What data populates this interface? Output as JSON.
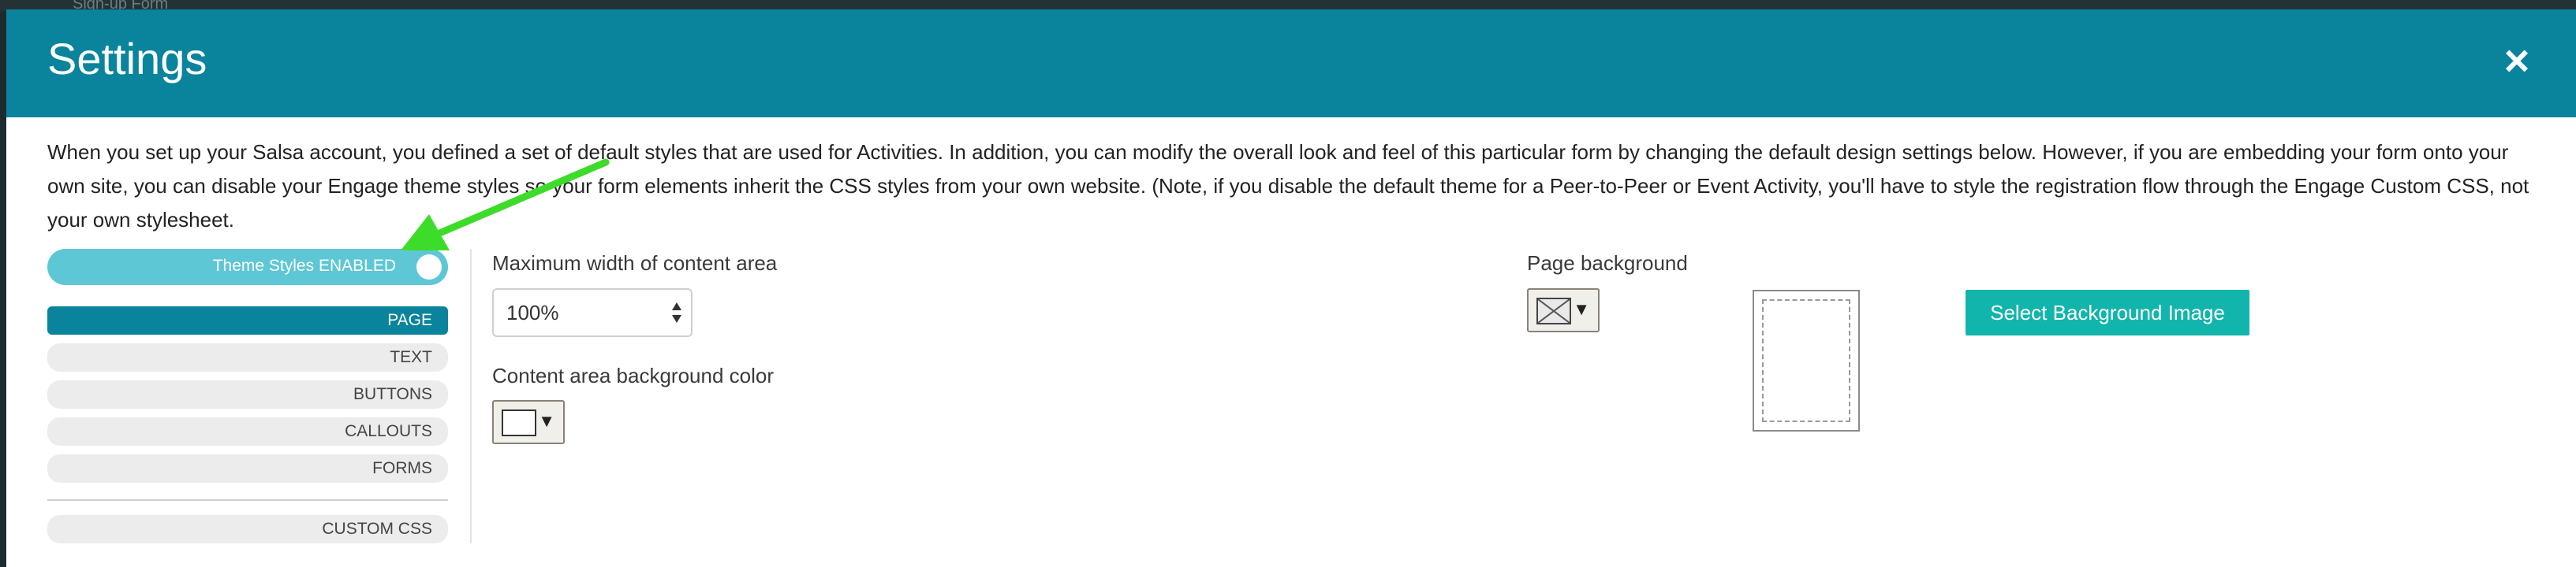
{
  "backdrop": {
    "partial_title": "Sign-up Form"
  },
  "dialog": {
    "title": "Settings",
    "close_glyph": "×",
    "intro": "When you set up your Salsa account, you defined a set of default styles that are used for Activities. In addition, you can modify the overall look and feel of this particular form by changing the default design settings below. However, if you are embedding your form onto your own site, you can disable your Engage theme styles so your form elements inherit the CSS styles from your own website. (Note, if you disable the default theme for a Peer-to-Peer or Event Activity, you'll have to style the registration flow through the Engage Custom CSS, not your own stylesheet."
  },
  "sidebar": {
    "theme_toggle": {
      "label": "Theme Styles ENABLED",
      "enabled": true
    },
    "items": [
      {
        "label": "PAGE",
        "active": true
      },
      {
        "label": "TEXT",
        "active": false
      },
      {
        "label": "BUTTONS",
        "active": false
      },
      {
        "label": "CALLOUTS",
        "active": false
      },
      {
        "label": "FORMS",
        "active": false
      }
    ],
    "custom_css": {
      "label": "CUSTOM CSS"
    }
  },
  "page_settings": {
    "max_width": {
      "label": "Maximum width of content area",
      "value": "100%"
    },
    "content_bg": {
      "label": "Content area background color",
      "color": "#ffffff"
    },
    "page_bg": {
      "label": "Page background",
      "color": null
    },
    "select_bg_image": {
      "label": "Select Background Image"
    }
  },
  "colors": {
    "header": "#0a849c",
    "toggle": "#5ec7d6",
    "button": "#12b5ab",
    "annotation_arrow": "#3ddc2a"
  },
  "icons": {
    "close": "close-icon",
    "spinner": "spinner-arrows-icon",
    "caret": "caret-down-icon",
    "empty_swatch": "empty-swatch-icon",
    "arrow": "annotation-arrow-icon"
  },
  "dropdown_caret": "▼"
}
